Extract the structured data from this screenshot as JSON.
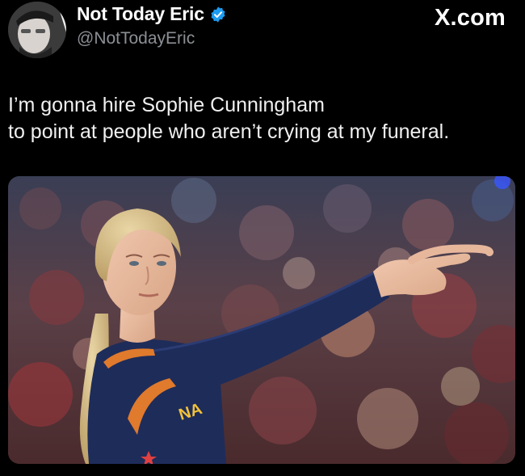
{
  "author": {
    "display_name": "Not Today Eric",
    "handle": "@NotTodayEric",
    "verified": true
  },
  "brand": "X.com",
  "tweet": {
    "lines": [
      "I’m gonna hire Sophie Cunningham",
      "to point at people who aren’t crying at my funeral."
    ]
  },
  "media": {
    "jersey_text": "NA"
  },
  "icons": [
    "avatar",
    "verified-badge-icon"
  ],
  "colors": {
    "background": "#000000",
    "verified_blue": "#1d9bf0",
    "handle_gray": "#8b8f94",
    "jersey_navy": "#1e2c5a",
    "jersey_orange": "#e07a2c"
  }
}
